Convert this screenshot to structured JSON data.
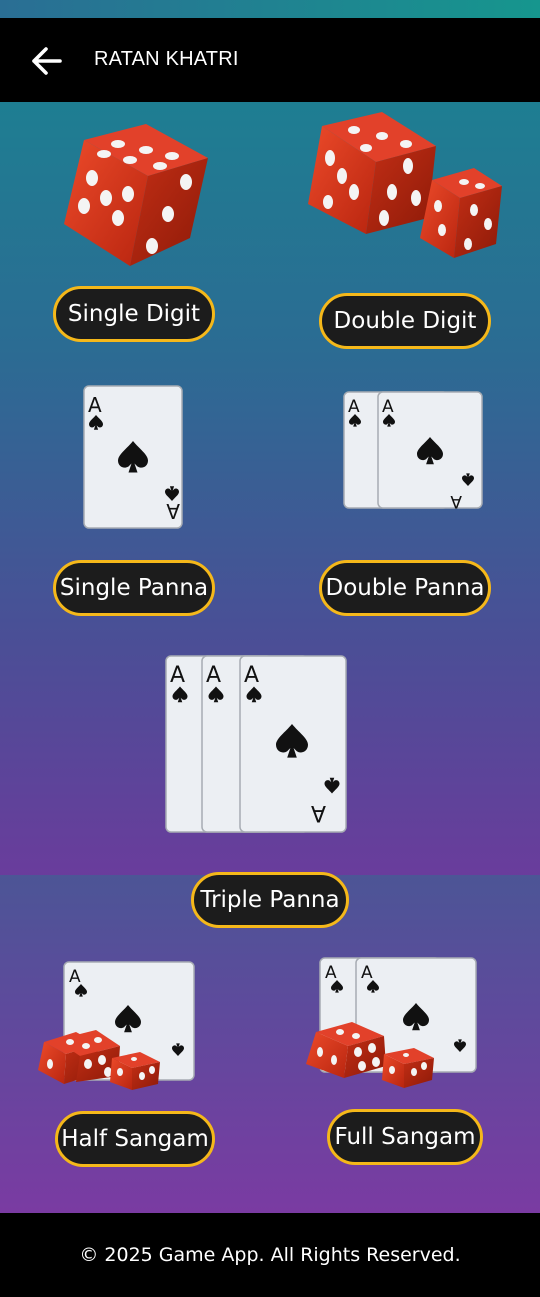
{
  "colors": {
    "accent": "#f5b81a",
    "appbar": "#000000",
    "pill_bg": "#1c1c1c",
    "dice_red": "#d63a1f"
  },
  "header": {
    "title": "RATAN KHATRI",
    "back_icon": "arrow-left-icon"
  },
  "games": [
    {
      "label": "Single Digit",
      "icon": "single-die-icon"
    },
    {
      "label": "Double Digit",
      "icon": "two-dice-icon"
    },
    {
      "label": "Single Panna",
      "icon": "one-ace-card-icon"
    },
    {
      "label": "Double Panna",
      "icon": "two-ace-cards-icon"
    },
    {
      "label": "Triple Panna",
      "icon": "three-ace-cards-icon"
    },
    {
      "label": "Half Sangam",
      "icon": "card-and-dice-icon"
    },
    {
      "label": "Full Sangam",
      "icon": "cards-and-dice-icon"
    }
  ],
  "card_rank": "A",
  "footer": {
    "copyright": "© 2025 Game App. All Rights Reserved."
  }
}
